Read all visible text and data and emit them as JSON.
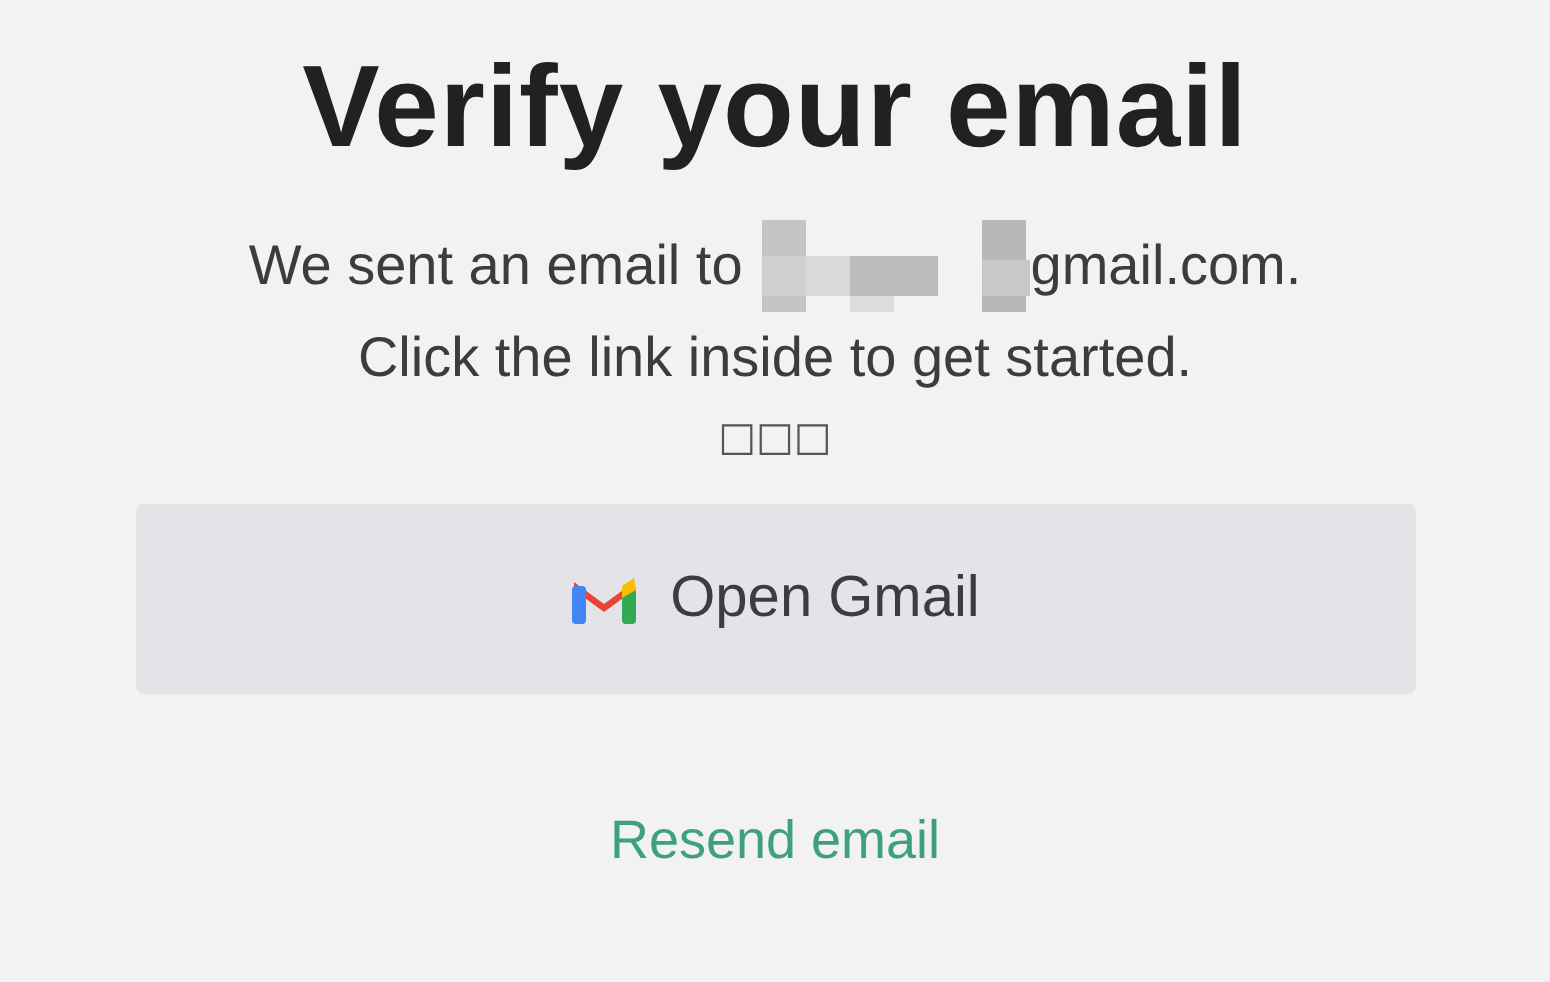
{
  "title": "Verify your email",
  "message": {
    "before_redaction": "We sent an email to",
    "after_redaction": "gmail.com.",
    "second_line": "Click the link inside to get started."
  },
  "placeholder_glyphs": "□□□",
  "open_button": {
    "label": "Open Gmail"
  },
  "resend_link": "Resend email"
}
